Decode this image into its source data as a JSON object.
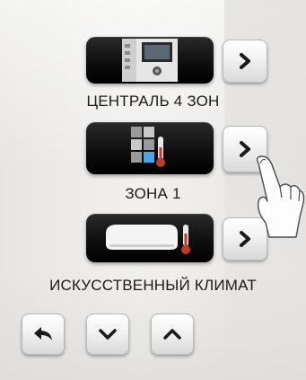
{
  "items": [
    {
      "label": "ЦЕНТРАЛЬ 4 ЗОН",
      "icon": "control-unit-icon"
    },
    {
      "label": "ЗОНА 1",
      "icon": "zone-thermometer-icon"
    },
    {
      "label": "ИСКУССТВЕННЫЙ КЛИМАТ",
      "icon": "air-conditioner-icon"
    }
  ],
  "colors": {
    "tile": "#000000",
    "accent": "#c0392b",
    "zone_blue": "#4fa3e0"
  }
}
